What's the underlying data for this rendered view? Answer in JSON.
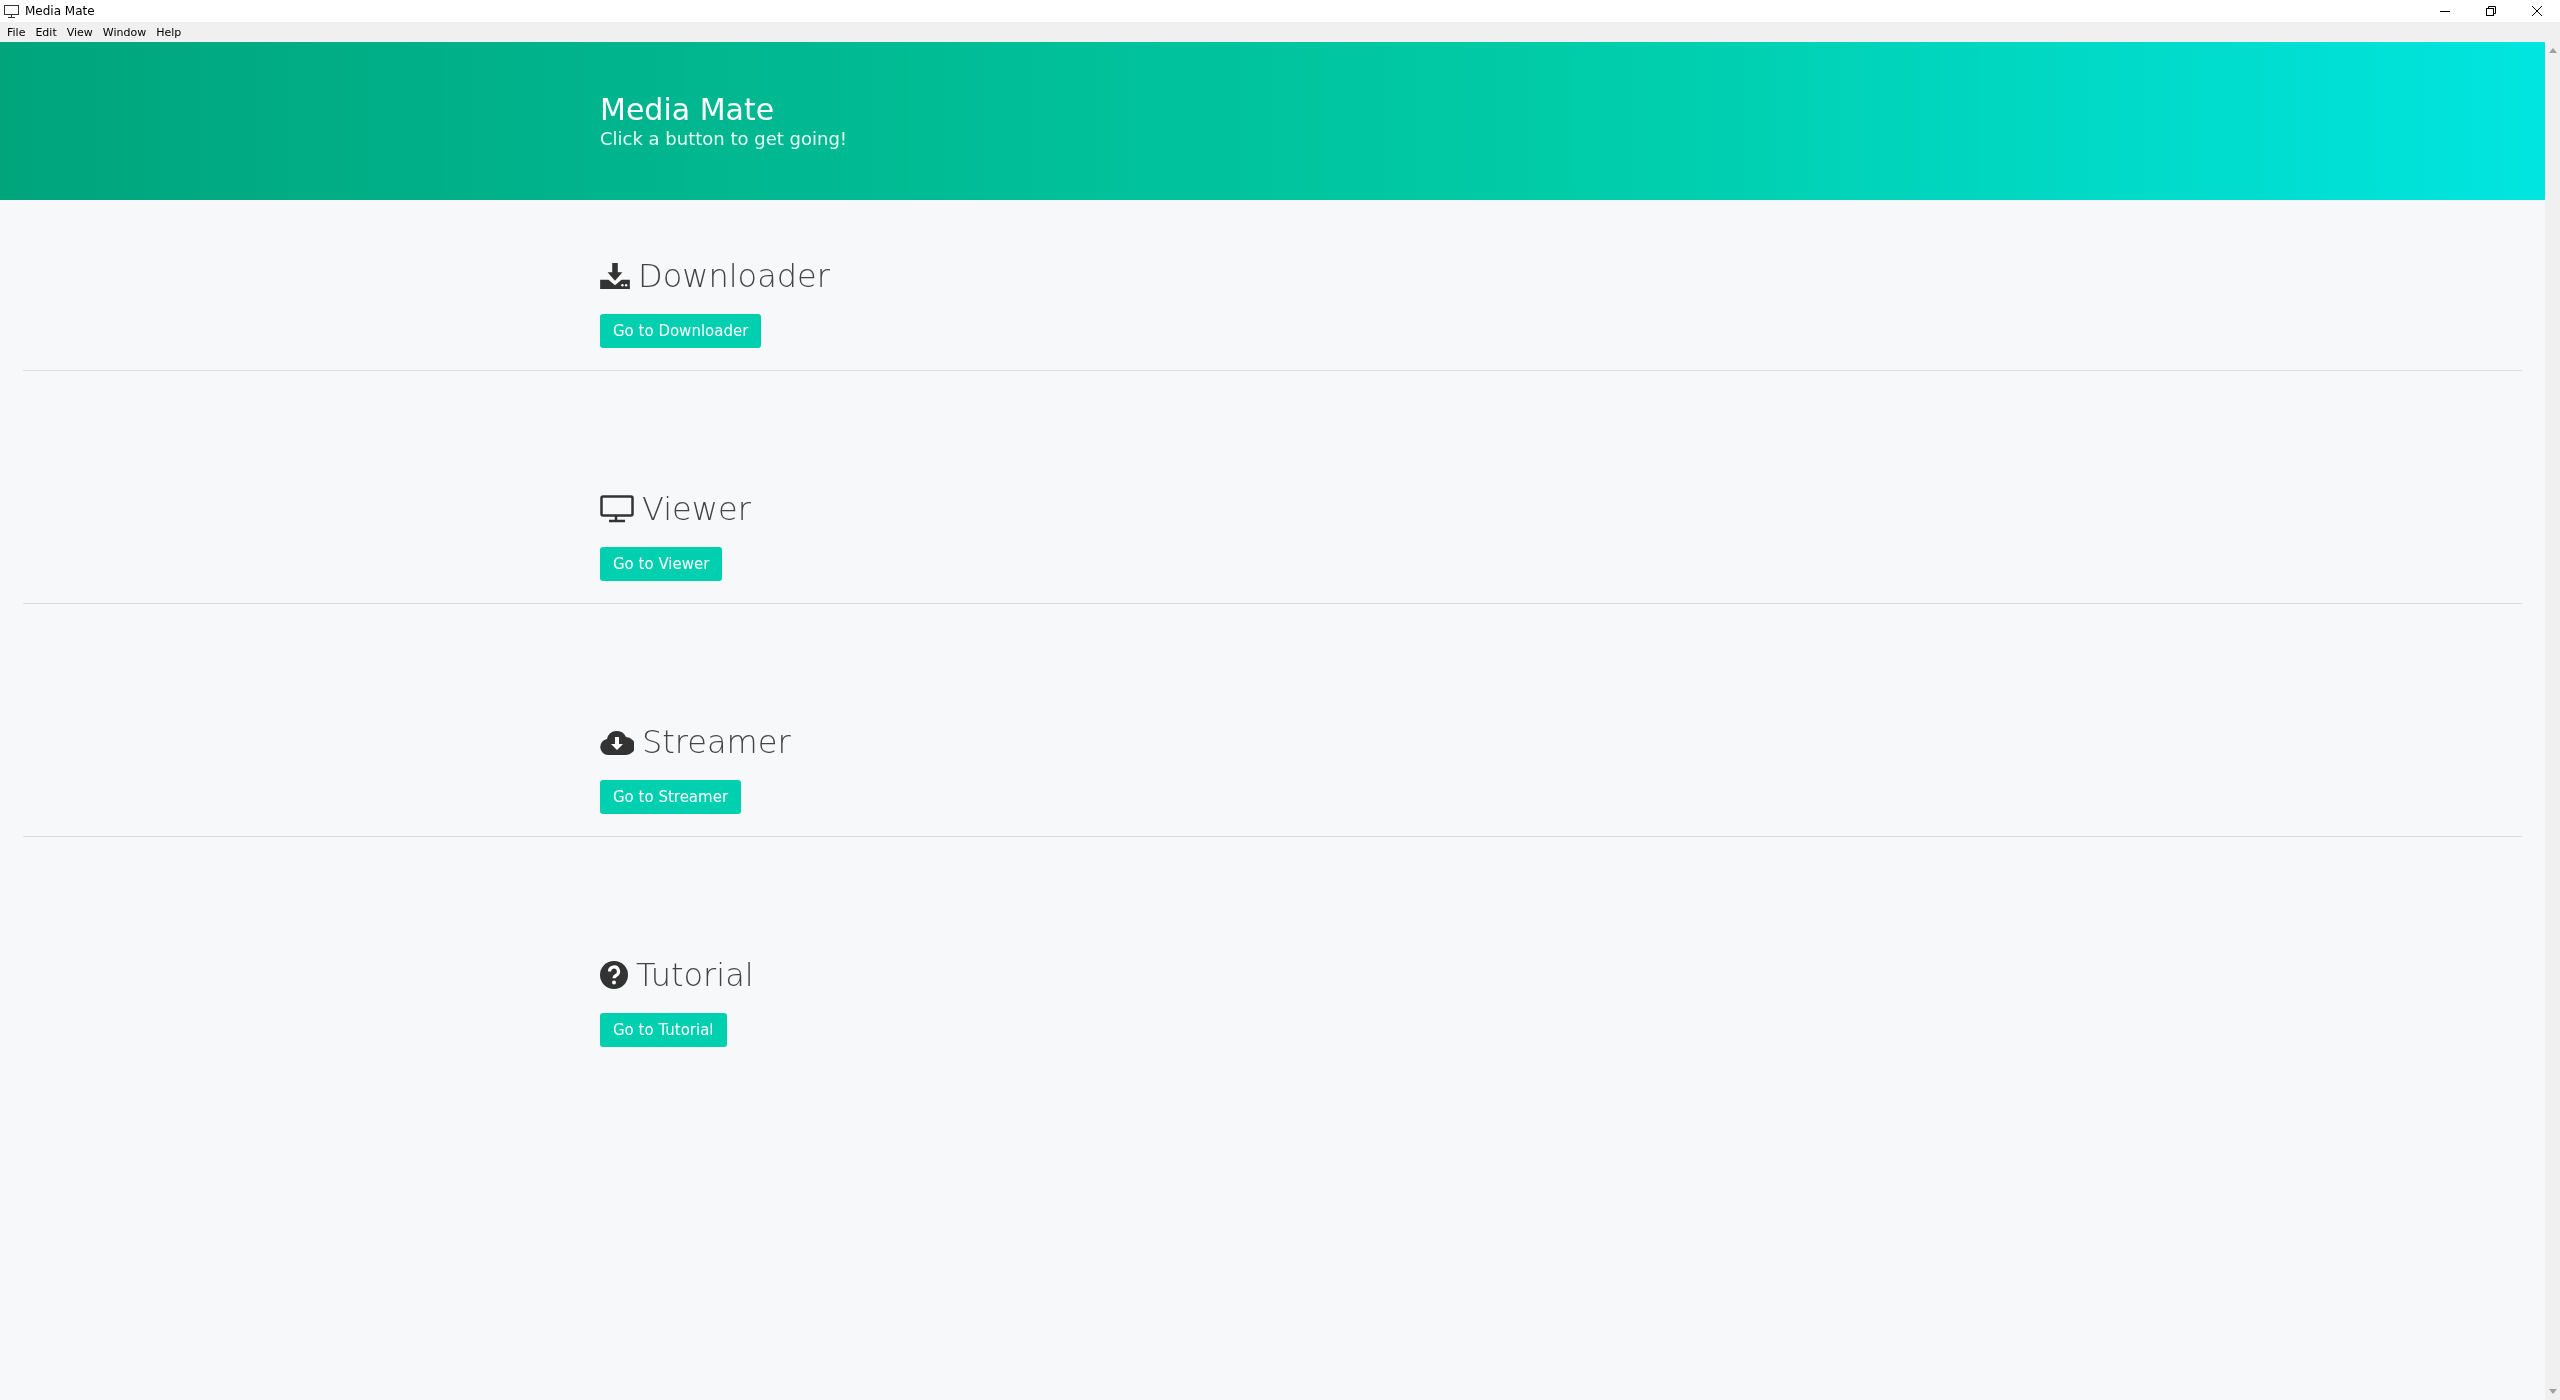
{
  "window": {
    "title": "Media Mate"
  },
  "menu": [
    "File",
    "Edit",
    "View",
    "Window",
    "Help"
  ],
  "header": {
    "title": "Media Mate",
    "subtitle": "Click a button to get going!"
  },
  "sections": [
    {
      "kind": "download",
      "title": "Downloader",
      "button": "Go to Downloader"
    },
    {
      "kind": "monitor",
      "title": "Viewer",
      "button": "Go to Viewer"
    },
    {
      "kind": "cloud",
      "title": "Streamer",
      "button": "Go to Streamer"
    },
    {
      "kind": "help",
      "title": "Tutorial",
      "button": "Go to Tutorial"
    }
  ]
}
